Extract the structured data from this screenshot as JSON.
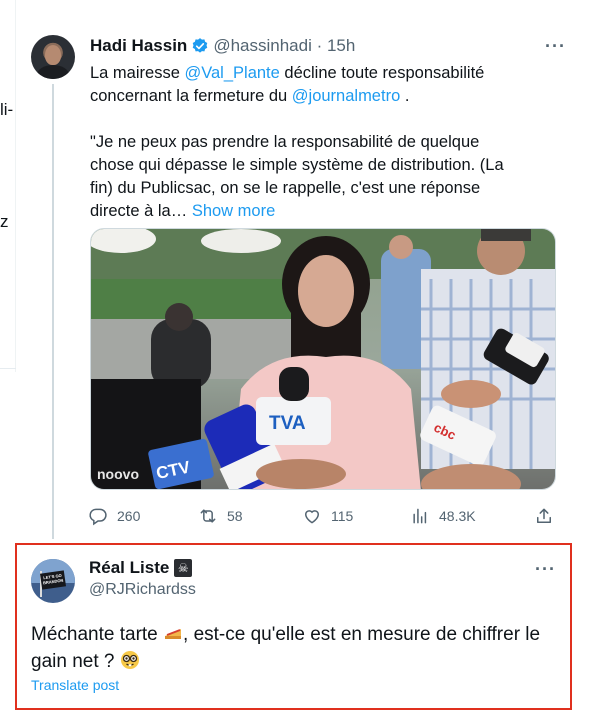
{
  "left_fragments": [
    "li-",
    "z"
  ],
  "tweet": {
    "author_name": "Hadi Hassin",
    "handle_time": "@hassinhadi · 15h",
    "more_label": "···",
    "line1_a": "La mairesse ",
    "mention1": "@Val_Plante",
    "line1_b": " décline toute responsabilité concernant la fermeture du ",
    "mention2": "@journalmetro",
    "line1_c": " .",
    "quote_text": "\"Je ne peux pas prendre la responsabilité de quelque chose qui dépasse le simple système de distribution. (La fin) du Publicsac, on se le rappelle, c'est une réponse directe à la…",
    "show_more": "Show more",
    "media": {
      "mic_labels": [
        "TVA",
        "CTV",
        "noovo",
        "cbc"
      ],
      "colors": {
        "jacket": "#f3c8c6",
        "hair": "#1d1716"
      }
    },
    "actions": {
      "replies": "260",
      "reposts": "58",
      "likes": "115",
      "views": "48.3K"
    }
  },
  "reply": {
    "author_name": "Réal Liste",
    "handle": "@RJRichardss",
    "more_label": "···",
    "avatar_text": "LET'S GO BRANDON",
    "text_a": "Méchante tarte ",
    "text_b": ", est-ce qu'elle est en mesure de chiffrer le gain net ? ",
    "translate": "Translate post"
  },
  "colors": {
    "accent": "#1d9bf0",
    "highlight_border": "#e0301e",
    "secondary_text": "#536471"
  }
}
